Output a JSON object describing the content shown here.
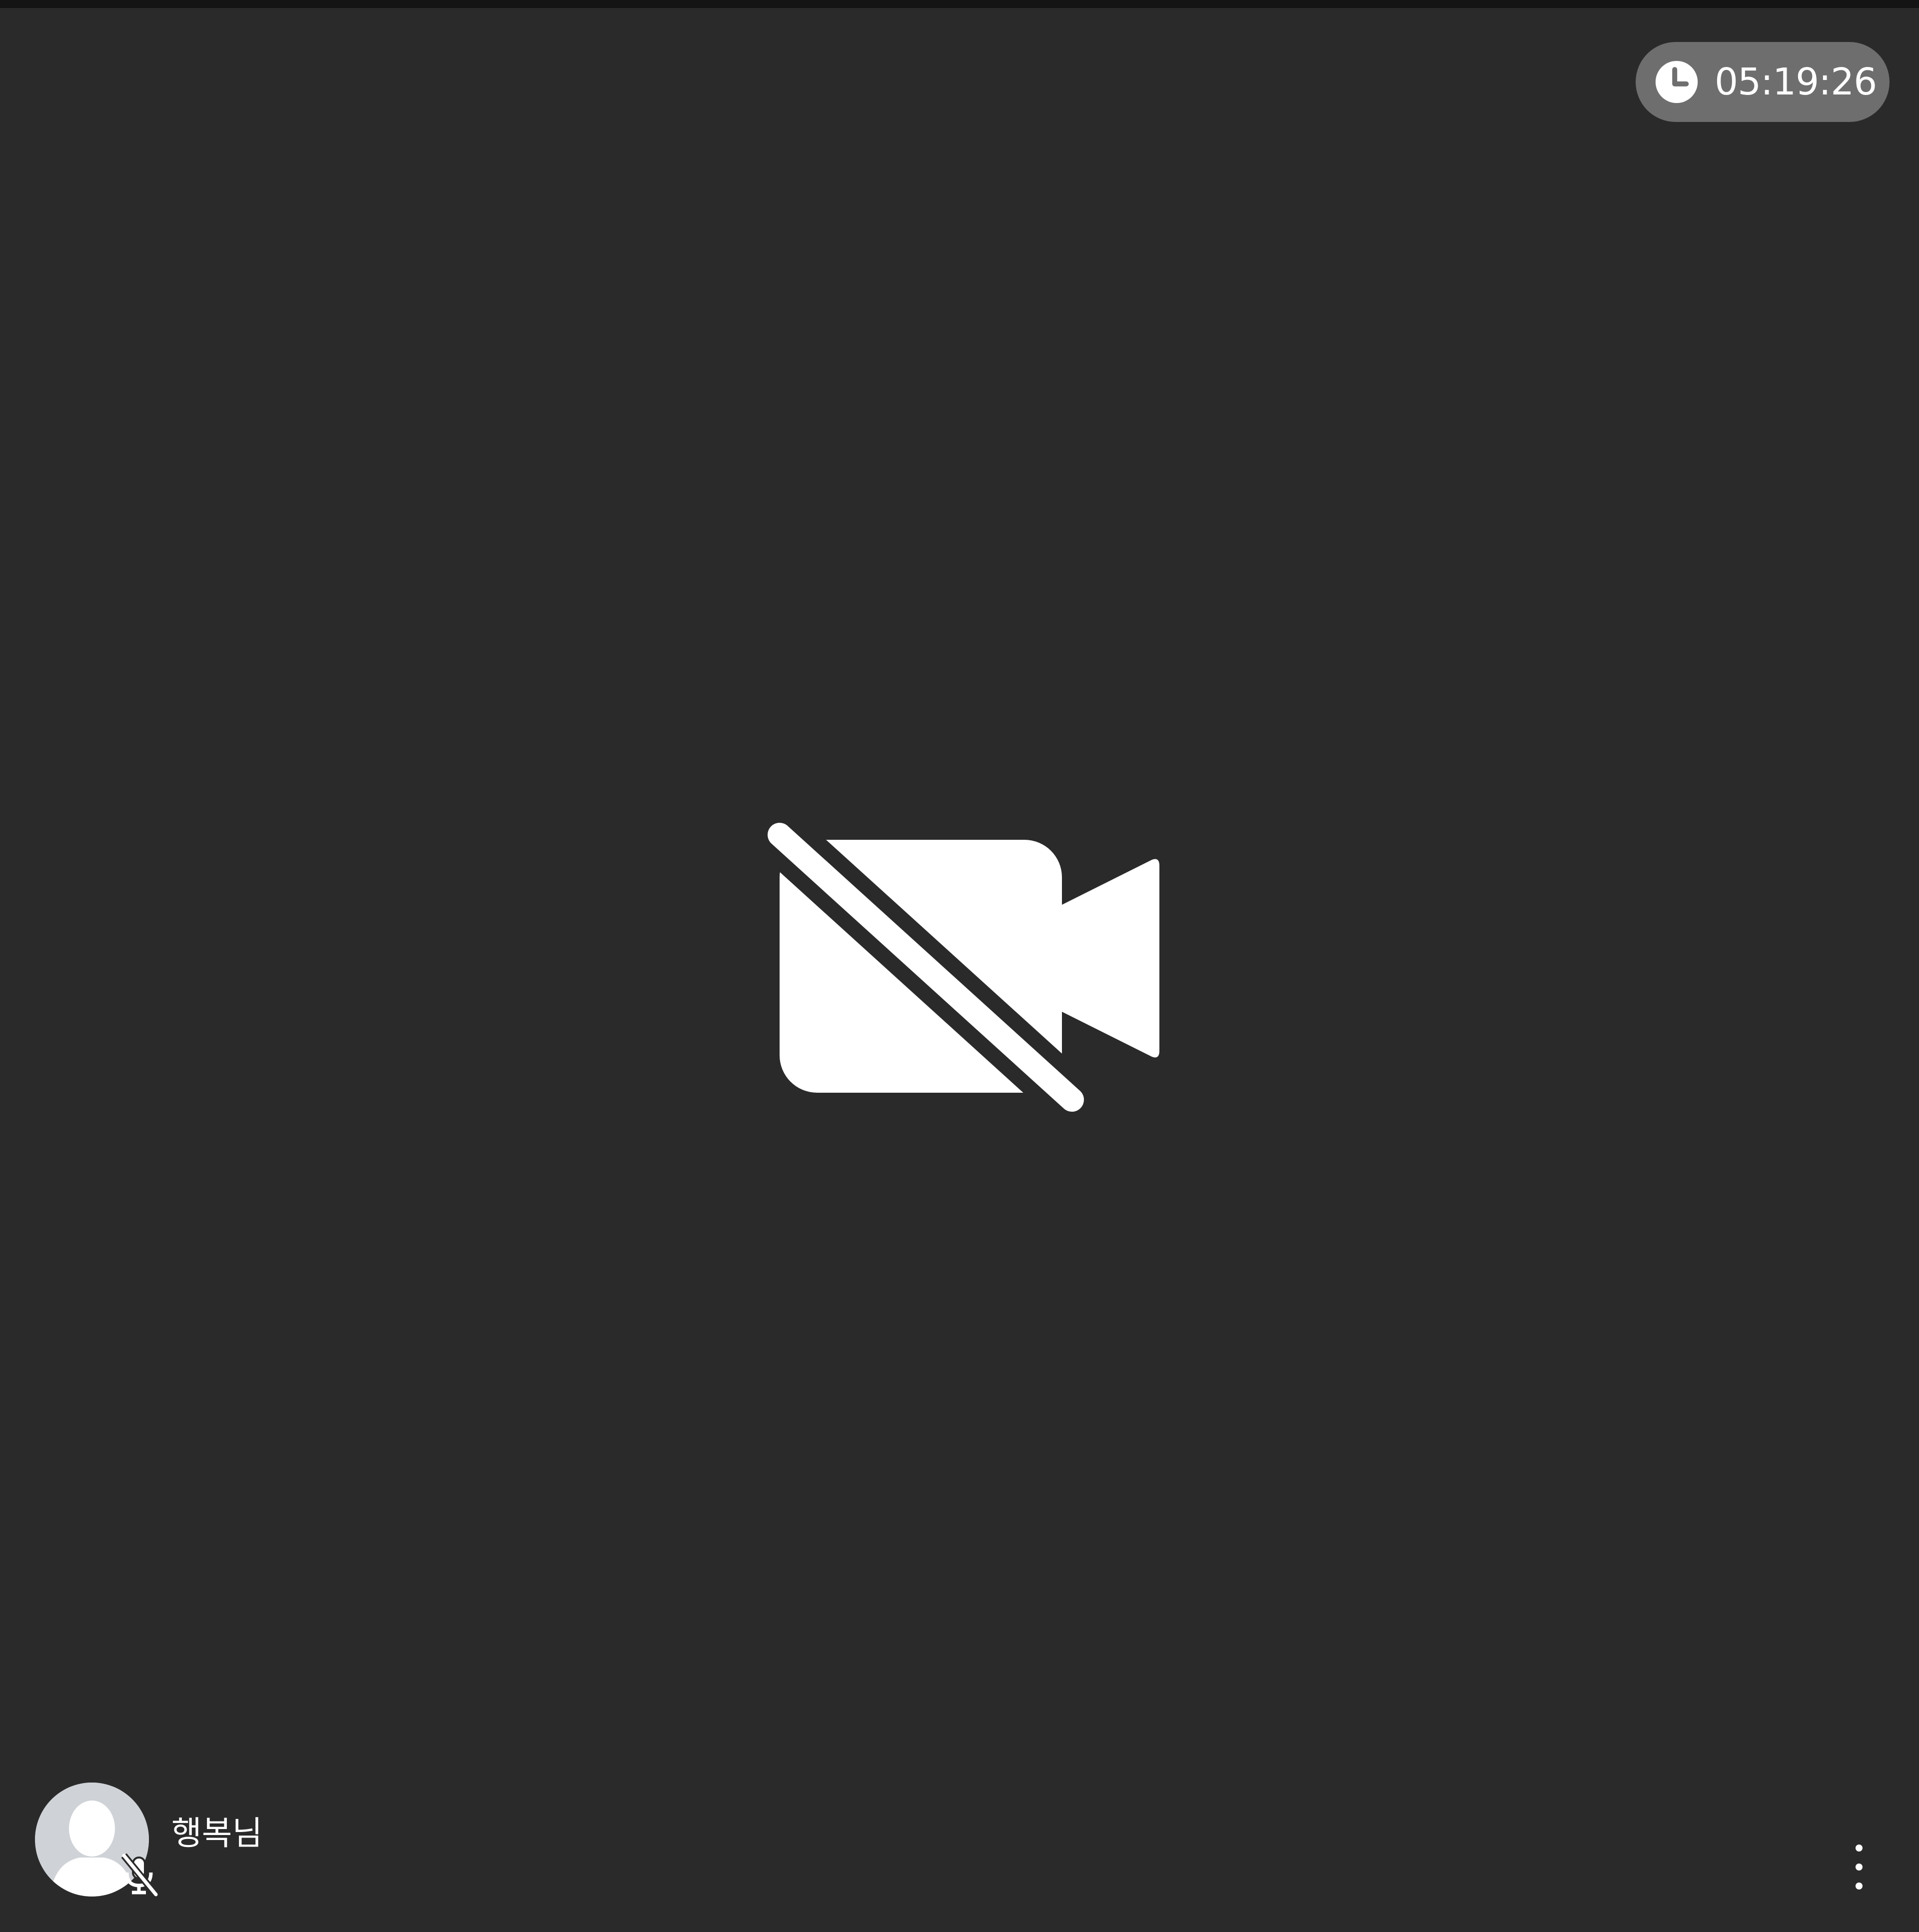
{
  "call": {
    "elapsed_time": "05:19:26",
    "camera_state_icon": "video-off-icon",
    "clock_icon": "clock-icon"
  },
  "participant": {
    "name": "행복님",
    "avatar_icon": "default-avatar-icon",
    "mic_icon": "mic-off-icon"
  },
  "controls": {
    "more_icon": "more-vertical-icon"
  },
  "colors": {
    "background": "#2a2a2a",
    "top_bar": "#141414",
    "timer_pill": "#6e6e6e",
    "icon": "#ffffff",
    "avatar_bg": "#cfd2d6"
  }
}
